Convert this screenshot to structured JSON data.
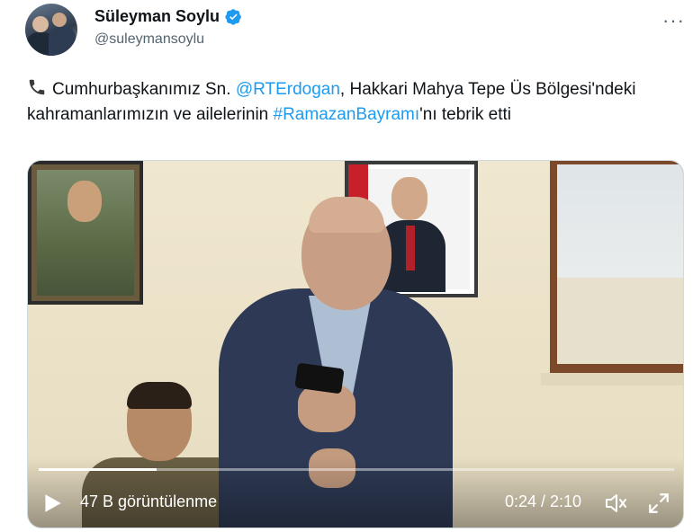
{
  "author": {
    "name": "Süleyman Soylu",
    "handle": "@suleymansoylu"
  },
  "menu": {
    "more_label": "···"
  },
  "tweet": {
    "part1": "Cumhurbaşkanımız Sn. ",
    "mention": "@RTErdogan",
    "part2": ", Hakkari Mahya Tepe Üs Bölgesi'ndeki kahramanlarımızın ve ailelerinin ",
    "hashtag": "#RamazanBayramı",
    "part3": "'nı tebrik etti"
  },
  "video": {
    "views": "47 B görüntülenme",
    "time": "0:24 / 2:10",
    "progress": 0.185
  },
  "colors": {
    "link": "#1d9bf0",
    "verified": "#1d9bf0"
  }
}
